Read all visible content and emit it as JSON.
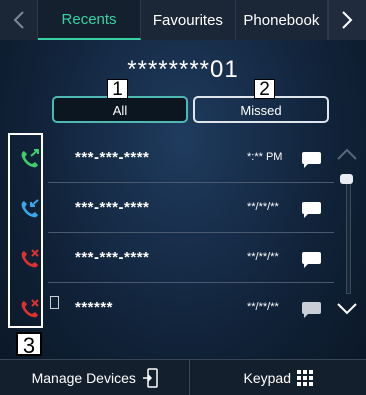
{
  "tabs": [
    {
      "label": "Recents",
      "active": true
    },
    {
      "label": "Favourites",
      "active": false
    },
    {
      "label": "Phonebook",
      "active": false
    }
  ],
  "caller_id": "********01",
  "filters": {
    "all": "All",
    "missed": "Missed"
  },
  "annotations": {
    "one": "1",
    "two": "2",
    "three": "3"
  },
  "calls": [
    {
      "number": "***-***-****",
      "time": "*:** PM",
      "icon": "outgoing-call-icon"
    },
    {
      "number": "***-***-****",
      "time": "**/**/**",
      "icon": "incoming-call-icon"
    },
    {
      "number": "***-***-****",
      "time": "**/**/**",
      "icon": "missed-call-icon"
    },
    {
      "number": "******",
      "time": "**/**/**",
      "icon": "missed-call-icon"
    }
  ],
  "bottom": {
    "manage": "Manage Devices",
    "keypad": "Keypad"
  },
  "colors": {
    "accent": "#37d3a3",
    "outgoing": "#3fcf6a",
    "incoming": "#3aa6e8",
    "missed": "#e0312f"
  }
}
